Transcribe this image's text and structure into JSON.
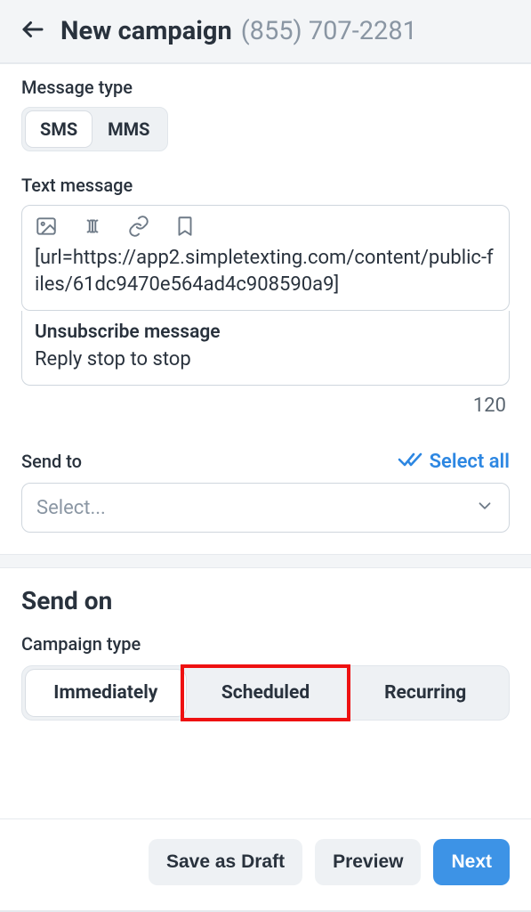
{
  "header": {
    "title": "New campaign",
    "phone": "(855) 707-2281"
  },
  "message_type": {
    "label": "Message type",
    "options": [
      "SMS",
      "MMS"
    ],
    "selected": "SMS"
  },
  "text_message": {
    "label": "Text message",
    "content": "[url=https://app2.simpletexting.com/content/public-files/61dc9470e564ad4c908590a9]",
    "unsubscribe_title": "Unsubscribe message",
    "unsubscribe_text": "Reply stop to stop",
    "char_count": "120",
    "toolbar_icons": [
      "image-icon",
      "merge-field-icon",
      "link-icon",
      "bookmark-icon"
    ]
  },
  "send_to": {
    "label": "Send to",
    "select_all_label": "Select all",
    "placeholder": "Select..."
  },
  "send_on": {
    "title": "Send on",
    "campaign_type_label": "Campaign type",
    "options": [
      "Immediately",
      "Scheduled",
      "Recurring"
    ],
    "selected": "Immediately",
    "highlighted": "Scheduled"
  },
  "footer": {
    "save_draft": "Save as Draft",
    "preview": "Preview",
    "next": "Next"
  }
}
